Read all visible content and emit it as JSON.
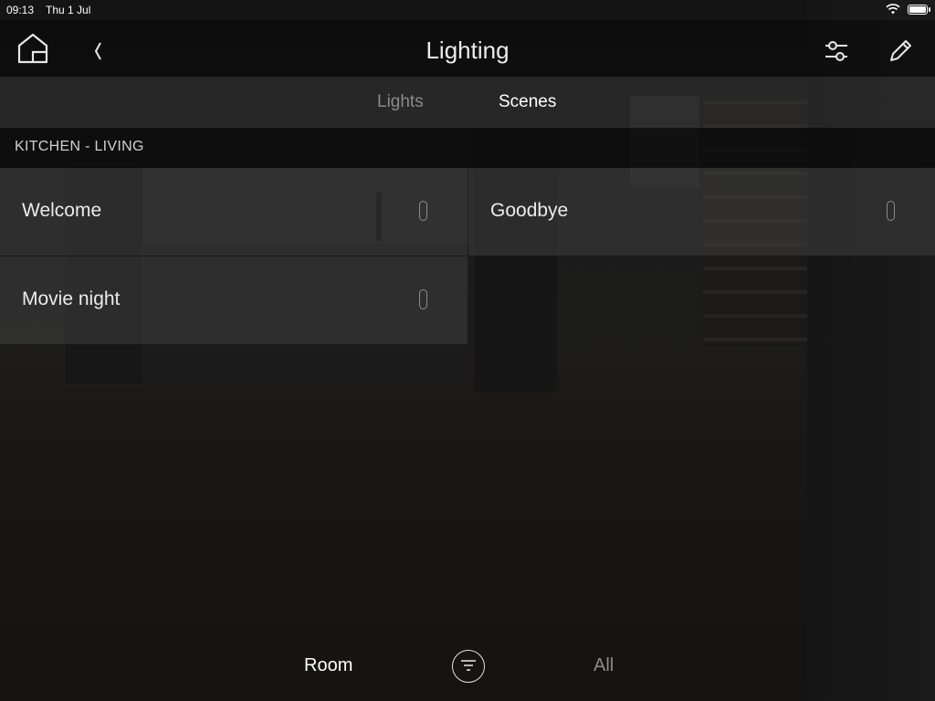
{
  "status_bar": {
    "time": "09:13",
    "date": "Thu 1 Jul"
  },
  "header": {
    "title": "Lighting"
  },
  "tabs": [
    {
      "label": "Lights",
      "active": false
    },
    {
      "label": "Scenes",
      "active": true
    }
  ],
  "section": {
    "title": "KITCHEN - LIVING"
  },
  "scenes": [
    {
      "label": "Welcome"
    },
    {
      "label": "Goodbye"
    },
    {
      "label": "Movie night"
    }
  ],
  "bottom_bar": {
    "room_label": "Room",
    "all_label": "All"
  },
  "colors": {
    "active_text": "#ffffff",
    "inactive_text": "#8a8a8a",
    "tile_bg": "#484848"
  },
  "icons": [
    "home-icon",
    "back-chevron-icon",
    "sliders-icon",
    "pencil-icon",
    "filter-icon",
    "wifi-icon",
    "battery-icon"
  ]
}
